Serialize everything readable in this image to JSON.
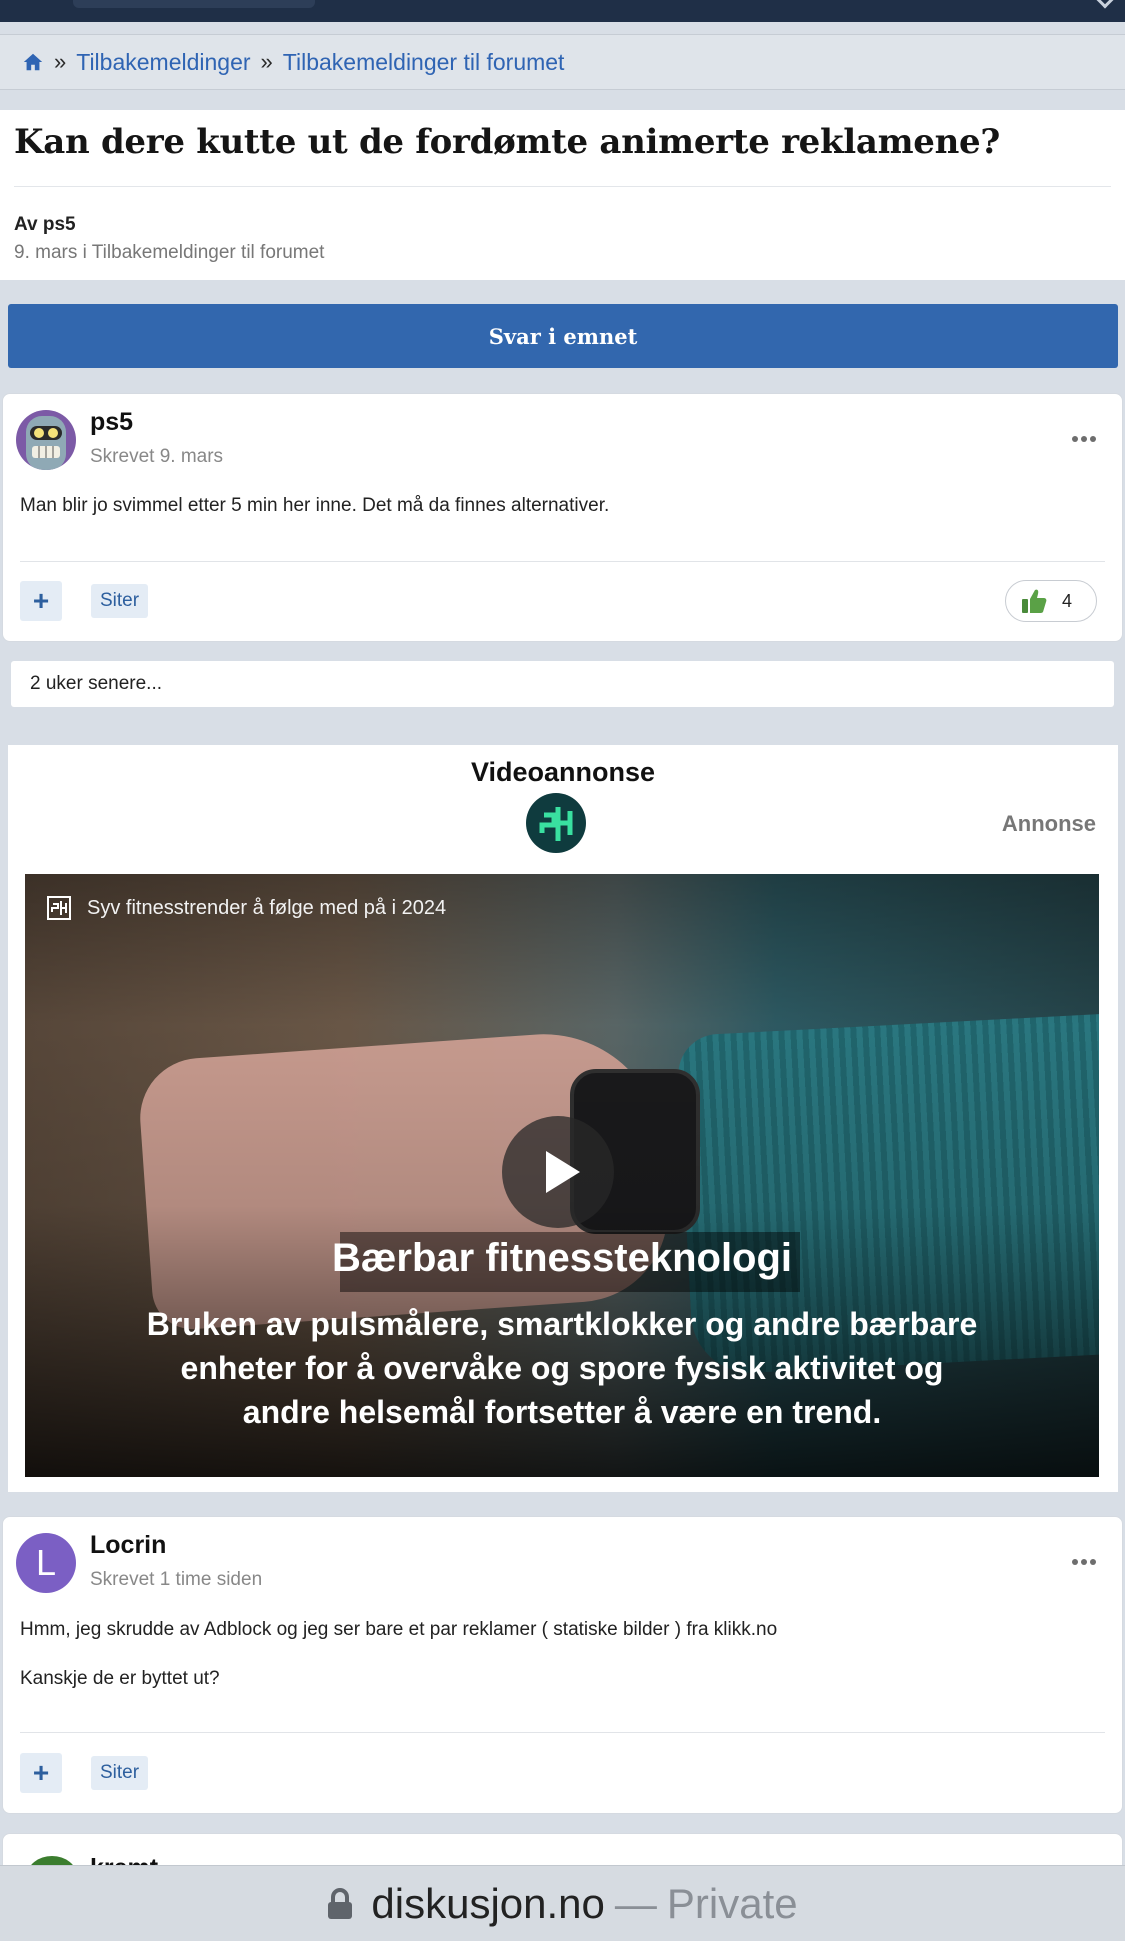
{
  "breadcrumb": {
    "home_icon": "home-icon",
    "separator": "»",
    "items": [
      "Tilbakemeldinger",
      "Tilbakemeldinger til forumet"
    ]
  },
  "topic": {
    "title": "Kan dere kutte ut de fordømte animerte reklamene?",
    "author_line": "Av ps5",
    "meta_line": "9. mars i Tilbakemeldinger til forumet"
  },
  "reply_button": "Svar i emnet",
  "posts": [
    {
      "username": "ps5",
      "posted": "Skrevet 9. mars",
      "paragraphs": [
        "Man blir jo svimmel etter 5 min her inne. Det må da finnes alternativer."
      ],
      "plus_label": "+",
      "quote_label": "Siter",
      "likes": "4"
    },
    {
      "username": "Locrin",
      "avatar_letter": "L",
      "posted": "Skrevet 1 time siden",
      "paragraphs": [
        "Hmm, jeg skrudde av Adblock og jeg ser bare et par reklamer  ( statiske bilder ) fra klikk.no",
        "Kanskje de er byttet ut?"
      ],
      "plus_label": "+",
      "quote_label": "Siter"
    }
  ],
  "time_gap": "2 uker senere...",
  "ad": {
    "heading": "Videoannonse",
    "label": "Annonse",
    "video_title": "Syv fitnesstrender å følge med på i 2024",
    "headline": "Bærbar fitnessteknologi",
    "caption_lines": [
      "Bruken av pulsmålere, smartklokker og andre bærbare",
      "enheter for å overvåke og spore fysisk aktivitet og",
      "andre helsemål fortsetter å være en trend."
    ]
  },
  "next_post_peek": {
    "username": "kremt"
  },
  "address_bar": {
    "domain": "diskusjon.no",
    "separator": "—",
    "mode": "Private"
  },
  "colors": {
    "link": "#2f64b3",
    "button": "#3267ae",
    "nav": "#1f2f47",
    "page_bg": "#d8dee6",
    "ad_logo_bg": "#0f3b3e",
    "ad_logo_fg": "#39e0a0",
    "avatar_locrin": "#7b5fc4"
  }
}
